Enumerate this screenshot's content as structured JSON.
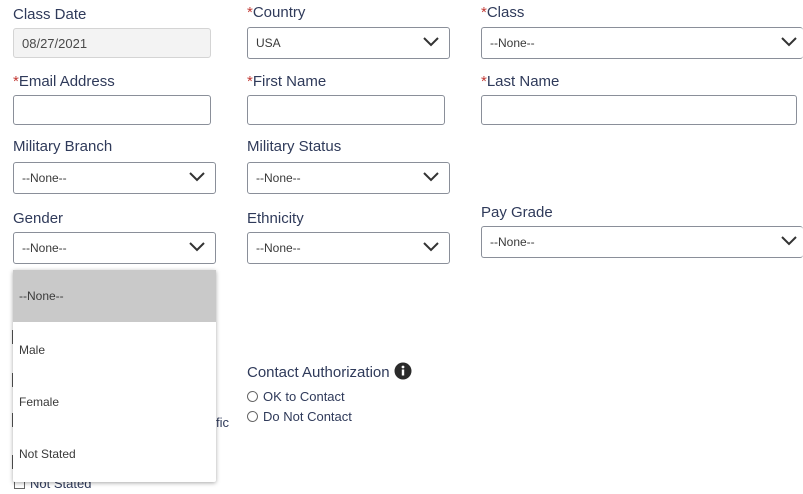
{
  "fields": {
    "class_date": {
      "label": "Class Date",
      "value": "08/27/2021"
    },
    "country": {
      "required_mark": "*",
      "label": "Country",
      "value": "USA"
    },
    "class": {
      "required_mark": "*",
      "label": "Class",
      "value": "--None--"
    },
    "email": {
      "required_mark": "*",
      "label": "Email Address",
      "value": ""
    },
    "first_name": {
      "required_mark": "*",
      "label": "First Name",
      "value": ""
    },
    "last_name": {
      "required_mark": "*",
      "label": "Last Name",
      "value": ""
    },
    "military_branch": {
      "label": "Military Branch",
      "value": "--None--"
    },
    "military_status": {
      "label": "Military Status",
      "value": "--None--"
    },
    "gender": {
      "label": "Gender",
      "value": "--None--"
    },
    "ethnicity": {
      "label": "Ethnicity",
      "value": "--None--"
    },
    "pay_grade": {
      "label": "Pay Grade",
      "value": "--None--"
    }
  },
  "gender_dropdown": {
    "options": [
      "--None--",
      "Male",
      "Female",
      "Not Stated"
    ],
    "selected_index": 0
  },
  "contact_authorization": {
    "label": "Contact Authorization",
    "options": [
      "OK to Contact",
      "Do Not Contact"
    ]
  },
  "partial": {
    "fic_text": "fic",
    "not_stated_checkbox": "Not Stated"
  },
  "icons": [
    "chevron-down-icon",
    "info-icon"
  ],
  "colors": {
    "required": "#c23934",
    "label": "#2f3a5a",
    "selected_option": "#c9c9c9"
  }
}
